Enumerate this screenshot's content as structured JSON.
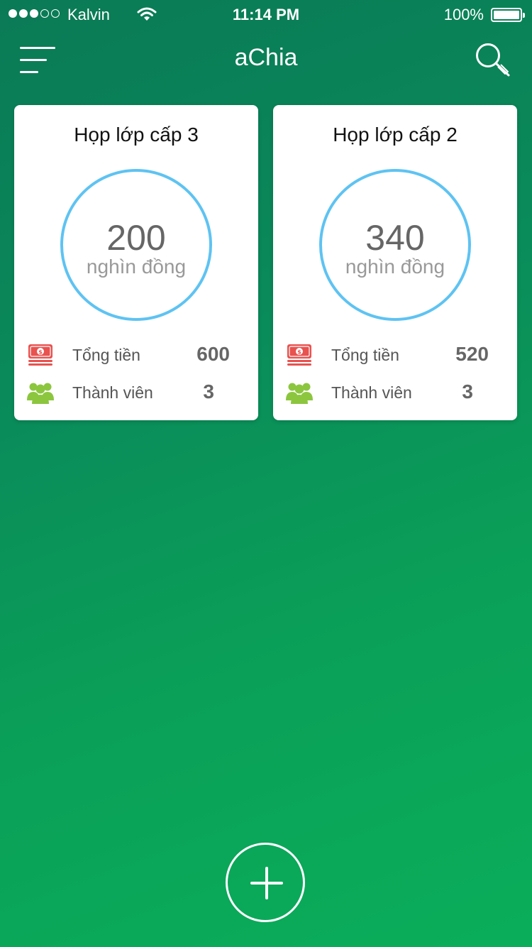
{
  "status_bar": {
    "carrier": "Kalvin",
    "time": "11:14 PM",
    "battery": "100%",
    "signal_bars_filled": 3,
    "signal_bars_total": 5
  },
  "nav": {
    "title": "aChia",
    "menu_icon": "hamburger-menu-icon",
    "search_icon": "search-icon"
  },
  "colors": {
    "ring": "#5ec3f2",
    "money_icon": "#e8524f",
    "members_icon": "#8cc63f",
    "background_start": "#0a7a56",
    "background_end": "#0aae5a"
  },
  "groups": [
    {
      "title": "Họp lớp cấp 3",
      "amount": "200",
      "unit": "nghìn đồng",
      "total_label": "Tổng tiền",
      "total_value": "600",
      "members_label": "Thành viên",
      "members_value": "3"
    },
    {
      "title": "Họp lớp cấp 2",
      "amount": "340",
      "unit": "nghìn đồng",
      "total_label": "Tổng tiền",
      "total_value": "520",
      "members_label": "Thành viên",
      "members_value": "3"
    }
  ],
  "fab": {
    "icon": "plus-icon"
  }
}
